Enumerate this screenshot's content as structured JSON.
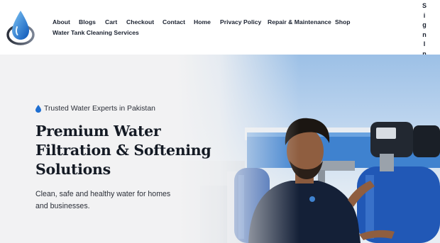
{
  "header": {
    "nav_items": [
      {
        "label": "About"
      },
      {
        "label": "Blogs"
      },
      {
        "label": "Cart"
      },
      {
        "label": "Checkout"
      },
      {
        "label": "Contact"
      },
      {
        "label": "Home"
      },
      {
        "label": "Privacy Policy"
      },
      {
        "label": "Repair & Maintenance"
      },
      {
        "label": "Shop"
      },
      {
        "label": "Water Tank Cleaning Services"
      }
    ],
    "signin_letters": [
      "S",
      "i",
      "g",
      "n",
      "I",
      "n"
    ]
  },
  "hero": {
    "badge_icon": "water-drop-icon",
    "badge_text": "Trusted Water Experts in Pakistan",
    "title_lines": [
      "Premium Water",
      "Filtration & Softening",
      "Solutions"
    ],
    "subtitle_lines": [
      "Clean, safe and healthy water for homes",
      "and businesses."
    ]
  },
  "colors": {
    "brand_blue": "#1f6fd1",
    "text_dark": "#141a24",
    "tank_blue": "#1d4fa6"
  }
}
